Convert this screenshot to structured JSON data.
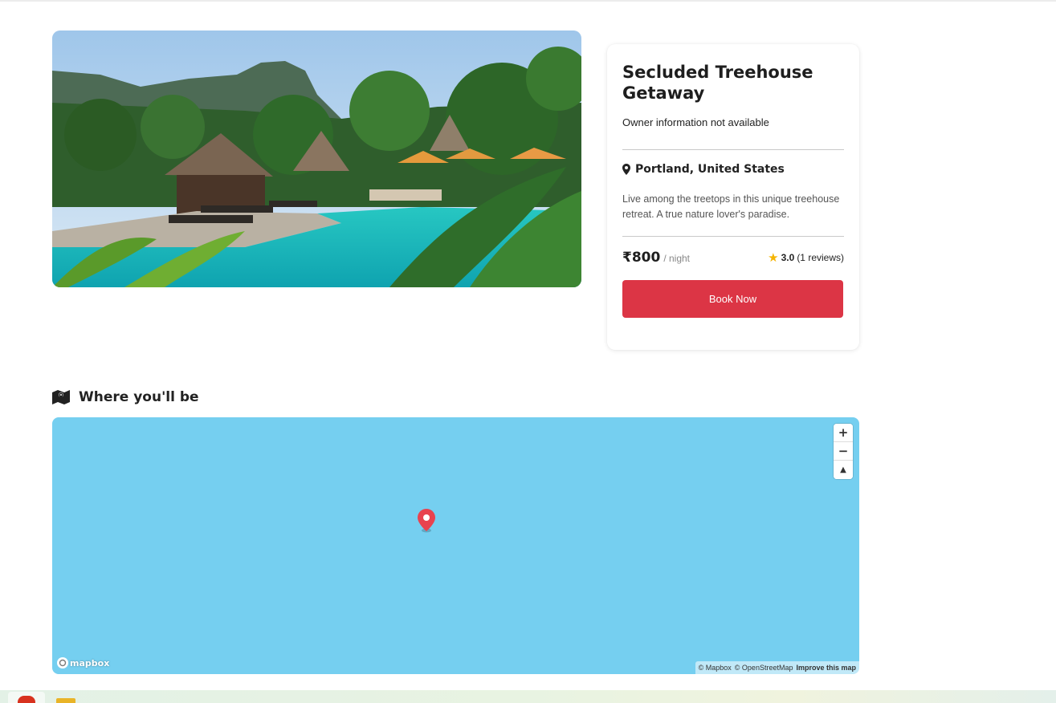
{
  "listing": {
    "title": "Secluded Treehouse Getaway",
    "owner_text": "Owner information not available",
    "location": "Portland, United States",
    "description": "Live among the treetops in this unique treehouse retreat. A true nature lover's paradise.",
    "price": "₹800",
    "per_night": "/ night",
    "rating_value": "3.0",
    "reviews_text": "(1 reviews)",
    "book_label": "Book Now"
  },
  "where_section": {
    "title": "Where you'll be"
  },
  "map": {
    "zoom_in_label": "+",
    "zoom_out_label": "−",
    "compass_label": "▲",
    "logo_text": "mapbox",
    "attrib_mapbox": "© Mapbox",
    "attrib_osm": "© OpenStreetMap",
    "improve_label": "Improve this map",
    "water_color": "#75cff0",
    "marker_color": "#e8434f"
  },
  "colors": {
    "accent_button": "#dc3545",
    "star": "#f5b400"
  },
  "icons": {
    "location": "map-pin-icon",
    "section": "folded-map-icon",
    "rating": "star-icon"
  }
}
